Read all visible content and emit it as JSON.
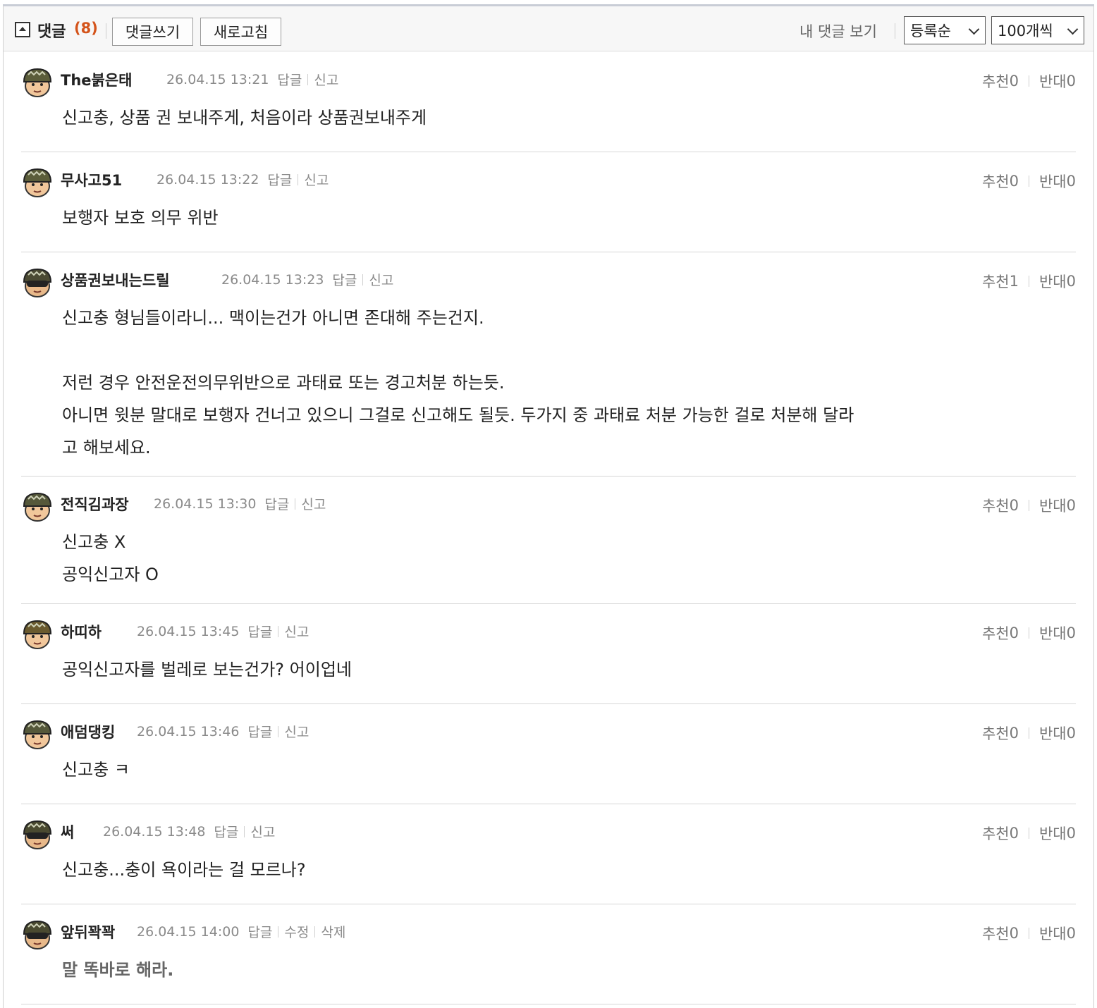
{
  "header": {
    "title": "댓글",
    "count": "(8)",
    "write_button": "댓글쓰기",
    "refresh_button": "새로고침",
    "my_comments_link": "내 댓글 보기",
    "sort_select": "등록순",
    "page_size_select": "100개씩"
  },
  "labels": {
    "reply": "답글",
    "report": "신고",
    "edit": "수정",
    "delete": "삭제",
    "recommend": "추천",
    "oppose": "반대"
  },
  "comments": [
    {
      "author": "The붉은태",
      "date": "26.04.15 13:21",
      "up": "0",
      "down": "0",
      "text": "신고충, 상품 권 보내주게, 처음이라 상품권보내주게"
    },
    {
      "author": "무사고51",
      "date": "26.04.15 13:22",
      "up": "0",
      "down": "0",
      "text": "보행자 보호 의무 위반"
    },
    {
      "author": "상품권보내는드릴",
      "date": "26.04.15 13:23",
      "up": "1",
      "down": "0",
      "text": "신고충 형님들이라니... 맥이는건가 아니면 존대해 주는건지.\n\n저런 경우 안전운전의무위반으로 과태료 또는 경고처분 하는듯.\n아니면 윗분 말대로 보행자 건너고 있으니 그걸로 신고해도 될듯. 두가지 중 과태료 처분 가능한 걸로 처분해 달라\n고 해보세요."
    },
    {
      "author": "전직김과장",
      "date": "26.04.15 13:30",
      "up": "0",
      "down": "0",
      "text": "신고충 X\n공익신고자 O"
    },
    {
      "author": "하띠하",
      "date": "26.04.15 13:45",
      "up": "0",
      "down": "0",
      "text": "공익신고자를 벌레로 보는건가? 어이업네"
    },
    {
      "author": "애덤댕킹",
      "date": "26.04.15 13:46",
      "up": "0",
      "down": "0",
      "text": "신고충 ㅋ"
    },
    {
      "author": "써",
      "date": "26.04.15 13:48",
      "up": "0",
      "down": "0",
      "text": "신고충...충이 욕이라는 걸 모르나?"
    },
    {
      "author": "앞뒤꽉꽉",
      "date": "26.04.15 14:00",
      "up": "0",
      "down": "0",
      "text": "말 똑바로 해라."
    }
  ]
}
